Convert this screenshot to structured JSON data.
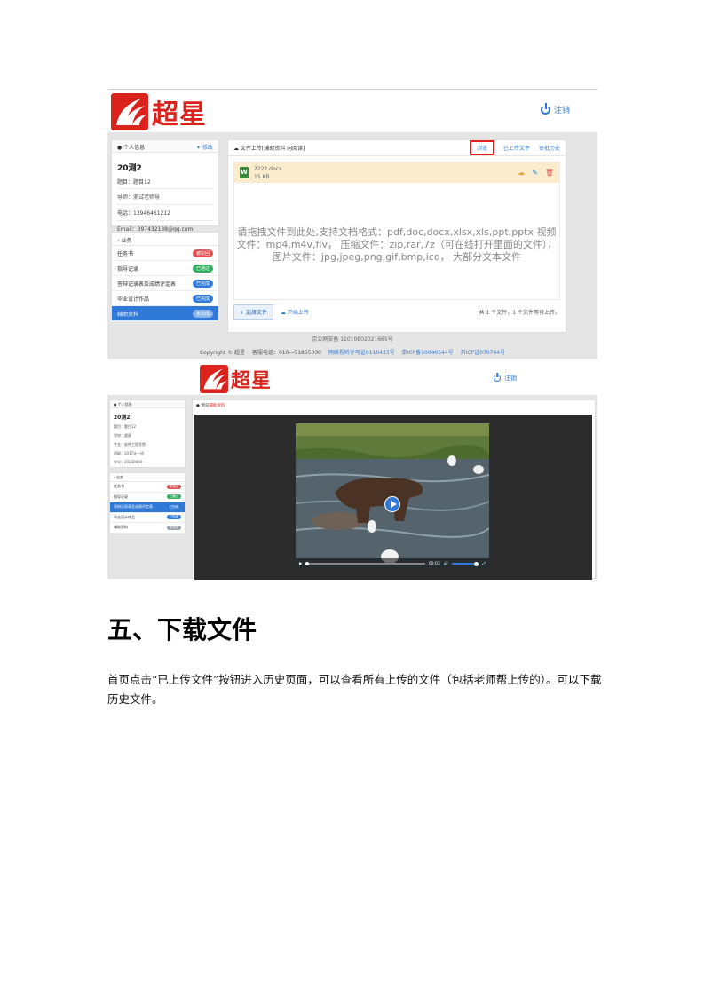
{
  "brand": {
    "logo_text": "超星"
  },
  "screenshot1": {
    "logout_label": "注销",
    "info_panel": {
      "title": "个人信息",
      "edit_label": "修改",
      "name": "20测2",
      "topic": "题目：题目12",
      "advisor": "导师：测试老师导",
      "phone": "电话：13946461212",
      "email": "Email：397432138@qq.com"
    },
    "business_panel": {
      "title": "业务",
      "items": [
        {
          "label": "任务书",
          "badge": "被驳回",
          "badge_color": "#e05050"
        },
        {
          "label": "指导记录",
          "badge": "已通过",
          "badge_color": "#2fae5c"
        },
        {
          "label": "答辩记录表及成绩评定表",
          "badge": "已完成",
          "badge_color": "#2f7ad8"
        },
        {
          "label": "毕业设计作品",
          "badge": "已完成",
          "badge_color": "#2f7ad8"
        },
        {
          "label": "辅助资料",
          "badge": "未完成",
          "badge_color": "#9aa4ad"
        }
      ]
    },
    "upload_panel": {
      "title": "文件上传[辅助资料 向阅读]",
      "tab_browse": "浏览",
      "tab_uploaded": "已上传文件",
      "tab_history": "审批历史",
      "file_name": "2222.docx",
      "file_size": "15 KB",
      "drop_text": "请拖拽文件到此处,支持文档格式：pdf,doc,docx,xlsx,xls,ppt,pptx 视频文件：mp4,m4v,flv， 压缩文件：zip,rar,7z（可在线打开里面的文件）， 图片文件：jpg,jpeg,png,gif,bmp,ico， 大部分文本文件",
      "choose_button": "选择文件",
      "start_upload": "开始上传",
      "count_text": "共 1 个文件，1 个文件等待上传。"
    },
    "footer": {
      "police_record": "京公网安备 11010802021665号",
      "copyright": "Copyright © 超星",
      "hotline": "客服电话：010—51855030",
      "license": "网络视听许可证0110433号",
      "icp": "京ICP备10040544号",
      "icp2": "京ICP证070744号"
    }
  },
  "screenshot2": {
    "logout_label": "注销",
    "info_panel": {
      "title": "个人信息",
      "name": "20测2",
      "rows": [
        "题目：题目12",
        "学校：超星",
        "专业：软件工程学院",
        "班级：2017计一班",
        "学号：20230060"
      ]
    },
    "business_panel": {
      "title": "业务",
      "items": [
        {
          "label": "任务书",
          "badge": "被驳回",
          "badge_color": "#e05050"
        },
        {
          "label": "指导记录",
          "badge": "已通过",
          "badge_color": "#2fae5c"
        },
        {
          "label": "答辩记录表及成绩评定表",
          "badge": "已完成",
          "badge_color": "#2f7ad8"
        },
        {
          "label": "毕业设计作品",
          "badge": "已完成",
          "badge_color": "#2f7ad8"
        },
        {
          "label": "辅助资料",
          "badge": "未完成",
          "badge_color": "#9aa4ad"
        }
      ]
    },
    "main_title_prefix": "预览",
    "main_title_highlight": "辅助资料",
    "video_time": "00:03"
  },
  "section": {
    "heading": "五、下载文件",
    "paragraph": "首页点击“已上传文件”按钮进入历史页面，可以查看所有上传的文件（包括老师帮上传的）。可以下载历史文件。"
  }
}
